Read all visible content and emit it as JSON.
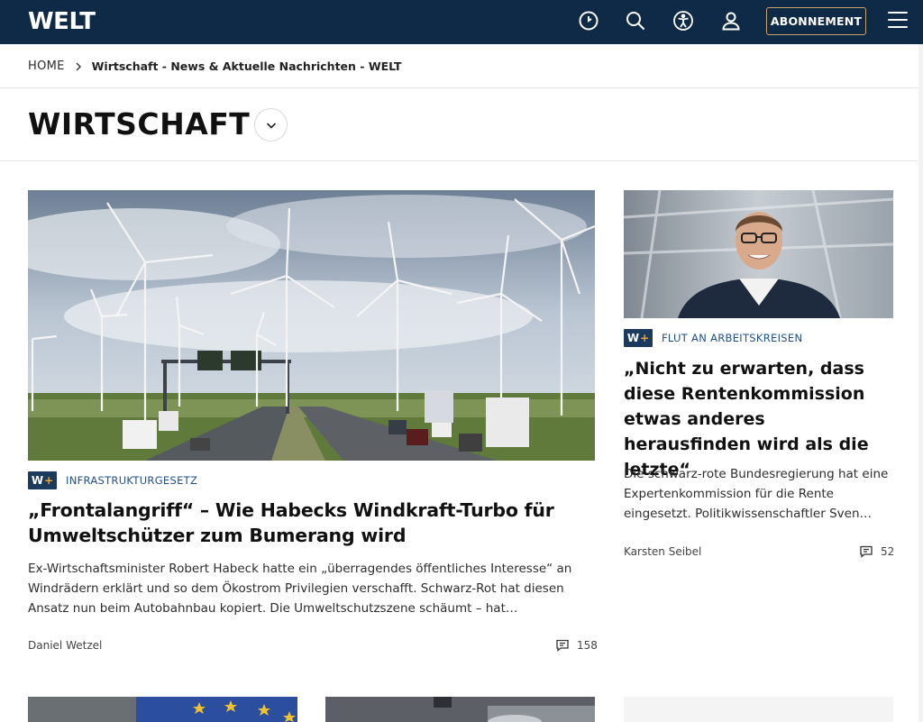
{
  "header": {
    "logo": "WELT",
    "icons": [
      "clock-icon",
      "search-icon",
      "accessibility-icon",
      "user-icon",
      "menu-icon"
    ],
    "subscribe_label": "ABONNEMENT",
    "bg_color": "#0f2a46",
    "accent_border": "#c9a36a"
  },
  "breadcrumb": {
    "home": "HOME",
    "current": "Wirtschaft - News & Aktuelle Nachrichten - WELT"
  },
  "section": {
    "title": "WIRTSCHAFT"
  },
  "lead_article": {
    "image_alt": "windpark-autobahn-image",
    "badge": "W+",
    "kicker": "INFRASTRUKTURGESETZ",
    "headline": "„Frontalangriff“ – Wie Habecks Windkraft-Turbo für Umweltschützer zum Bumerang wird",
    "teaser": "Ex-Wirtschaftsminister Robert Habeck hatte ein „überragendes öffentliches Interesse“ an Windrädern erklärt und so dem Ökostrom Privilegien verschafft. Schwarz-Rot hat diesen Ansatz nun beim Autobahnbau kopiert. Die Umweltschutzszene schäumt – hat…",
    "author": "Daniel Wetzel",
    "comments": "158"
  },
  "side_article": {
    "image_alt": "portrait-image",
    "badge": "W+",
    "kicker": "FLUT AN ARBEITSKREISEN",
    "headline": "„Nicht zu erwarten, dass diese Rentenkommission etwas anderes herausfinden wird als die letzte“",
    "teaser": "Die schwarz-rote Bundesregierung hat eine Expertenkommission für die Rente eingesetzt. Politikwissenschaftler Sven…",
    "author": "Karsten Seibel",
    "comments": "52"
  },
  "colors": {
    "kicker": "#1f4f86",
    "badge_bg": "#1b3a5c",
    "badge_plus": "#f2a33a"
  }
}
